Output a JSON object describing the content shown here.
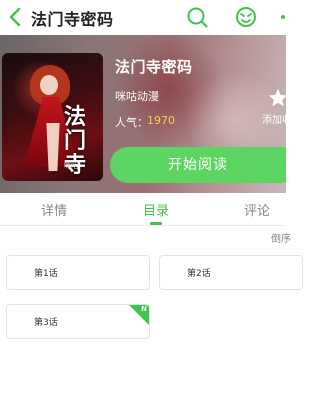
{
  "header": {
    "title": "法门寺密码",
    "icons": [
      "back-icon",
      "search-icon",
      "face-icon",
      "more-icon"
    ]
  },
  "book": {
    "title": "法门寺密码",
    "publisher": "咪咕动漫",
    "popularity_label": "人气：",
    "popularity_value": "1970",
    "cover_text": "法门寺",
    "cover_brand": "咪咕",
    "favorite_label": "添加收",
    "read_button_label": "开始阅读"
  },
  "tabs": [
    {
      "label": "详情",
      "active": false
    },
    {
      "label": "目录",
      "active": true
    },
    {
      "label": "评论",
      "active": false
    }
  ],
  "catalog": {
    "sort_label": "倒序",
    "chapters": [
      {
        "label": "第1话",
        "is_new": false
      },
      {
        "label": "第2话",
        "is_new": false
      },
      {
        "label": "第3话",
        "is_new": true
      }
    ],
    "new_badge": "N"
  },
  "colors": {
    "accent": "#3ec64a",
    "button": "#5dd562",
    "popularity": "#f6d04d"
  }
}
